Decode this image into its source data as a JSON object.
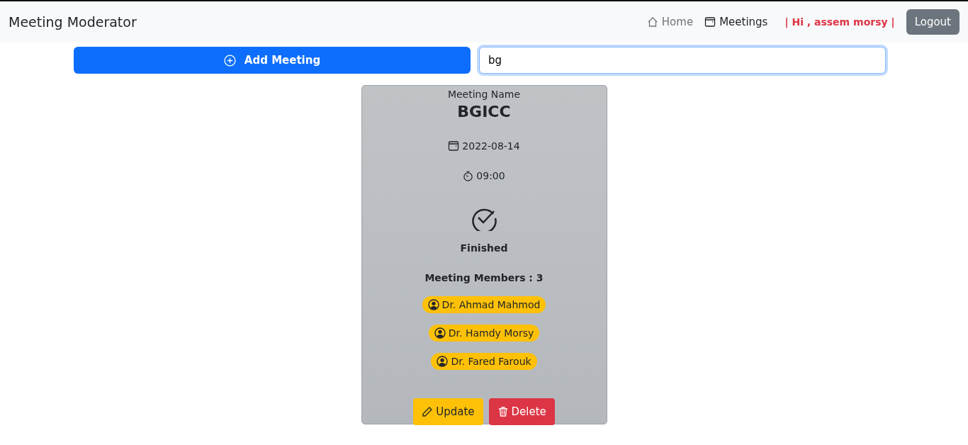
{
  "navbar": {
    "brand": "Meeting Moderator",
    "links": [
      {
        "label": "Home",
        "kind": "home",
        "selected": false
      },
      {
        "label": "Meetings",
        "kind": "meetings",
        "selected": true
      }
    ],
    "greeting": "| Hi , assem morsy |",
    "logout": "Logout"
  },
  "toolbar": {
    "add_button": "Add Meeting",
    "search": {
      "value": "bg"
    }
  },
  "meeting": {
    "caption": "Meeting Name",
    "name": "BGICC",
    "date": "2022-08-14",
    "time": "09:00",
    "status": {
      "kind": "finished",
      "label": "Finished"
    },
    "members_heading": "Meeting Members : 3",
    "members": [
      "Dr. Ahmad Mahmod",
      "Dr. Hamdy Morsy",
      "Dr. Fared Farouk"
    ],
    "actions": [
      {
        "kind": "update",
        "label": "Update"
      },
      {
        "kind": "delete",
        "label": "Delete"
      }
    ]
  }
}
